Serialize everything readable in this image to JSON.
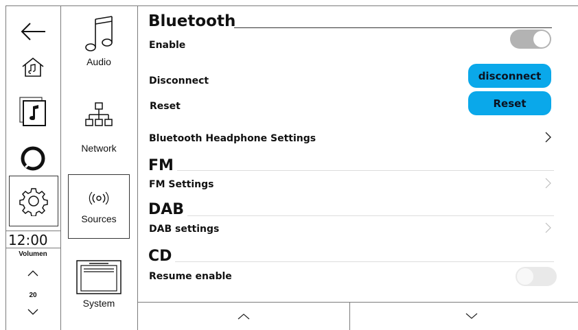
{
  "rail": {
    "clock": "12:00",
    "volume_label": "Volumen",
    "volume_value": "20",
    "icons": [
      "back-arrow-icon",
      "home-music-icon",
      "music-note-card-icon",
      "circle-icon",
      "gear-icon",
      "volume-up-icon",
      "volume-down-icon"
    ]
  },
  "categories": {
    "audio": "Audio",
    "network": "Network",
    "sources": "Sources",
    "system": "System"
  },
  "bluetooth": {
    "title": "Bluetooth",
    "enable_label": "Enable",
    "enable_on": true,
    "disconnect_label": "Disconnect",
    "disconnect_button": "disconnect",
    "reset_label": "Reset",
    "reset_button": "Reset",
    "headphone_settings": "Bluetooth Headphone Settings"
  },
  "fm": {
    "title": "FM",
    "settings": "FM Settings"
  },
  "dab": {
    "title": "DAB",
    "settings": "DAB settings"
  },
  "cd": {
    "title": "CD",
    "resume_label": "Resume enable",
    "resume_on": false
  },
  "colors": {
    "accent": "#0aa8ea",
    "toggle_on": "#b3b3b3",
    "toggle_off": "#e9e9e9"
  }
}
